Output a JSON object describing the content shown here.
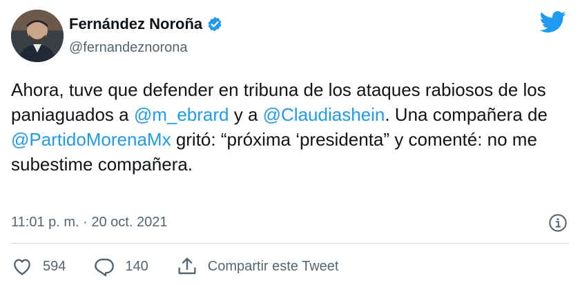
{
  "user": {
    "name": "Fernández Noroña",
    "handle": "@fernandeznorona",
    "verified_icon": "verified-badge-icon"
  },
  "tweet": {
    "segments": [
      {
        "text": "Ahora, tuve que defender en tribuna de los ataques rabiosos de los paniaguados a ",
        "mention": false
      },
      {
        "text": "@m_ebrard",
        "mention": true
      },
      {
        "text": " y a ",
        "mention": false
      },
      {
        "text": "@Claudiashein",
        "mention": true
      },
      {
        "text": ". Una compañera de ",
        "mention": false
      },
      {
        "text": "@PartidoMorenaMx",
        "mention": true
      },
      {
        "text": " gritó: “próxima ‘presidenta” y comenté: no me subestime compañera.",
        "mention": false
      }
    ],
    "timestamp": "11:01 p. m. · 20 oct. 2021"
  },
  "actions": {
    "likes": "594",
    "replies": "140",
    "share_label": "Compartir este Tweet"
  },
  "colors": {
    "accent": "#1d9bf0",
    "text": "#0f1419",
    "muted": "#536471"
  },
  "icons": [
    "twitter-bird-icon",
    "info-icon",
    "heart-icon",
    "reply-icon",
    "share-icon"
  ]
}
